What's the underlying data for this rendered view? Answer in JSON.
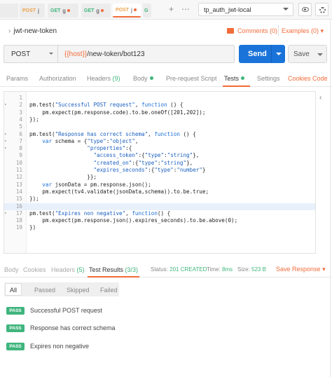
{
  "tabs": [
    {
      "method": "",
      "name": "",
      "dot": false
    },
    {
      "method": "POST",
      "name": "j",
      "dot": false
    },
    {
      "method": "GET",
      "name": "g",
      "dot": true
    },
    {
      "method": "GET",
      "name": "g",
      "dot": true
    },
    {
      "method": "POST",
      "name": "j",
      "dot": true
    },
    {
      "method": "G",
      "name": "",
      "dot": false
    }
  ],
  "tab_controls": {
    "add": "+",
    "more": "⋯"
  },
  "environment": {
    "selected": "tp_auth_jwt-local"
  },
  "request": {
    "name": "jwt-new-token",
    "comments_label": "Comments (0)",
    "examples_label": "Examples (0)",
    "method": "POST",
    "url_var": "{{host}}",
    "url_path": "/new-token/bot123",
    "send_label": "Send",
    "save_label": "Save"
  },
  "request_tabs": {
    "params": "Params",
    "authorization": "Authorization",
    "headers": "Headers",
    "headers_count": "(9)",
    "body": "Body",
    "prerequest": "Pre-request Script",
    "tests": "Tests",
    "settings": "Settings",
    "cookies": "Cookies",
    "code": "Code"
  },
  "code_lines": [
    {
      "n": "1",
      "fold": "",
      "text": ""
    },
    {
      "n": "2",
      "fold": "▾",
      "text": "pm.test(\"Successful POST request\", function () {"
    },
    {
      "n": "3",
      "fold": "",
      "text": "    pm.expect(pm.response.code).to.be.oneOf([201,202]);"
    },
    {
      "n": "4",
      "fold": "",
      "text": "});"
    },
    {
      "n": "5",
      "fold": "",
      "text": ""
    },
    {
      "n": "6",
      "fold": "▾",
      "text": "pm.test(\"Response has correct schema\", function () {"
    },
    {
      "n": "7",
      "fold": "▾",
      "text": "    var schema = {\"type\":\"object\","
    },
    {
      "n": "8",
      "fold": "▾",
      "text": "                  \"properties\":{"
    },
    {
      "n": "9",
      "fold": "",
      "text": "                    \"access_token\":{\"type\":\"string\"},"
    },
    {
      "n": "10",
      "fold": "",
      "text": "                    \"created_on\":{\"type\":\"string\"},"
    },
    {
      "n": "11",
      "fold": "",
      "text": "                    \"expires_seconds\":{\"type\":\"number\"}"
    },
    {
      "n": "12",
      "fold": "",
      "text": "                  }};"
    },
    {
      "n": "13",
      "fold": "",
      "text": "    var jsonData = pm.response.json();"
    },
    {
      "n": "14",
      "fold": "",
      "text": "    pm.expect(tv4.validate(jsonData,schema)).to.be.true;"
    },
    {
      "n": "15",
      "fold": "",
      "text": "});"
    },
    {
      "n": "16",
      "fold": "",
      "text": ""
    },
    {
      "n": "17",
      "fold": "▾",
      "text": "pm.test(\"Expires non negative\", function() {"
    },
    {
      "n": "18",
      "fold": "",
      "text": "    pm.expect(pm.response.json().expires_seconds).to.be.above(0);"
    },
    {
      "n": "19",
      "fold": "",
      "text": "})"
    }
  ],
  "response_tabs": {
    "body": "Body",
    "cookies": "Cookies",
    "headers": "Headers",
    "headers_count": "(5)",
    "test_results": "Test Results",
    "test_results_count": "(3/3)"
  },
  "response_status": {
    "status_label": "Status:",
    "status_value": "201 CREATED",
    "time_label": "Time:",
    "time_value": "8ms",
    "size_label": "Size:",
    "size_value": "523 B",
    "save_response": "Save Response"
  },
  "filters": [
    "All",
    "Passed",
    "Skipped",
    "Failed"
  ],
  "results": [
    {
      "badge": "PASS",
      "name": "Successful POST request"
    },
    {
      "badge": "PASS",
      "name": "Response has correct schema"
    },
    {
      "badge": "PASS",
      "name": "Expires non negative"
    }
  ],
  "colors": {
    "accent": "#f26b3a",
    "send": "#1a73d9",
    "pass": "#3fb57d"
  }
}
